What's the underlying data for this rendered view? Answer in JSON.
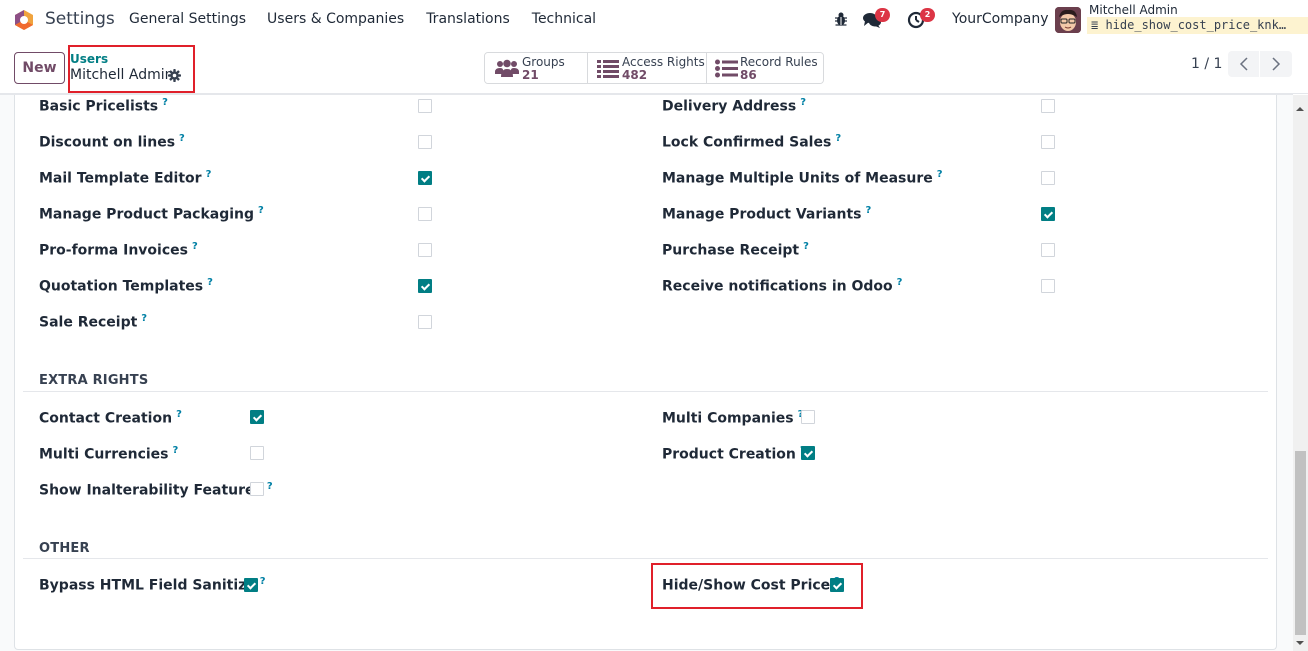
{
  "navbar": {
    "app_title": "Settings",
    "menu": [
      "General Settings",
      "Users & Companies",
      "Translations",
      "Technical"
    ],
    "chat_badge": "7",
    "activity_badge": "2",
    "company": "YourCompany",
    "user_name": "Mitchell Admin",
    "database": "hide_show_cost_price_knk…"
  },
  "control_panel": {
    "new_label": "New",
    "breadcrumb_parent": "Users",
    "breadcrumb_current": "Mitchell Admin",
    "stats": [
      {
        "label": "Groups",
        "value": "21",
        "icon": "users-icon"
      },
      {
        "label": "Access Rights",
        "value": "482",
        "icon": "list-icon"
      },
      {
        "label": "Record Rules",
        "value": "86",
        "icon": "list-ul-icon"
      }
    ],
    "pager": "1 / 1"
  },
  "colors": {
    "brand": "#714b67",
    "accent": "#017e84",
    "highlight": "#e0202a",
    "badge": "#dc3545"
  },
  "technical": {
    "left": [
      {
        "label": "Basic Pricelists",
        "checked": false
      },
      {
        "label": "Discount on lines",
        "checked": false
      },
      {
        "label": "Mail Template Editor",
        "checked": true
      },
      {
        "label": "Manage Product Packaging",
        "checked": false
      },
      {
        "label": "Pro-forma Invoices",
        "checked": false
      },
      {
        "label": "Quotation Templates",
        "checked": true
      },
      {
        "label": "Sale Receipt",
        "checked": false
      }
    ],
    "right": [
      {
        "label": "Delivery Address",
        "checked": false
      },
      {
        "label": "Lock Confirmed Sales",
        "checked": false
      },
      {
        "label": "Manage Multiple Units of Measure",
        "checked": false
      },
      {
        "label": "Manage Product Variants",
        "checked": true
      },
      {
        "label": "Purchase Receipt",
        "checked": false
      },
      {
        "label": "Receive notifications in Odoo",
        "checked": false
      }
    ]
  },
  "extra_rights": {
    "title": "EXTRA RIGHTS",
    "left": [
      {
        "label": "Contact Creation",
        "checked": true
      },
      {
        "label": "Multi Currencies",
        "checked": false
      },
      {
        "label": "Show Inalterability Features",
        "checked": false
      }
    ],
    "right": [
      {
        "label": "Multi Companies",
        "checked": false
      },
      {
        "label": "Product Creation",
        "checked": true
      }
    ]
  },
  "other": {
    "title": "OTHER",
    "left": [
      {
        "label": "Bypass HTML Field Sanitize",
        "checked": true
      }
    ],
    "right": [
      {
        "label": "Hide/Show Cost Price",
        "checked": true
      }
    ]
  },
  "help_marker": "?"
}
